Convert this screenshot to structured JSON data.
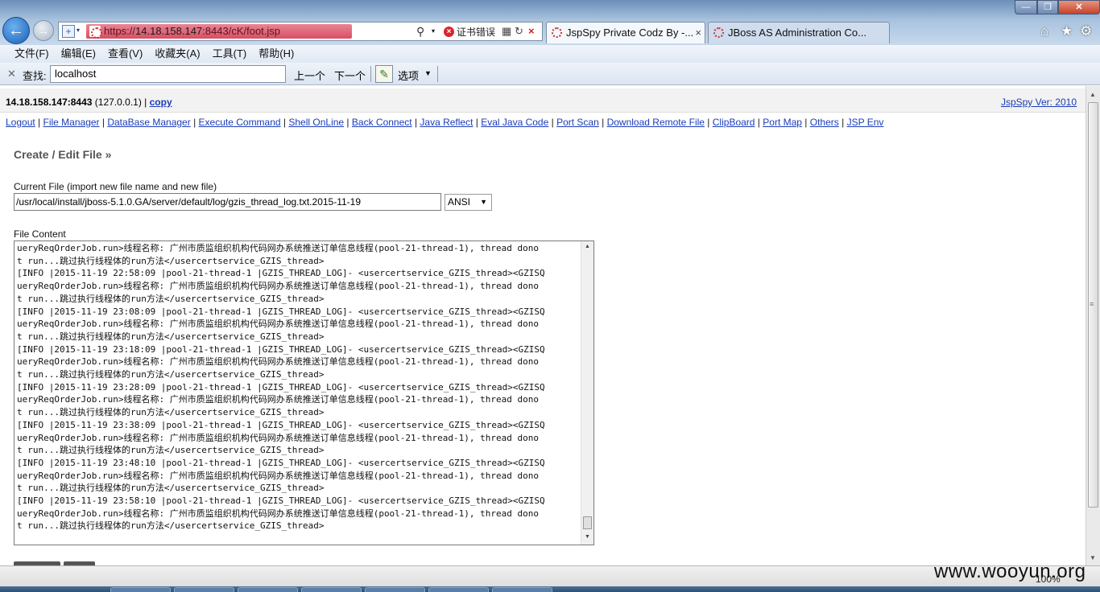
{
  "browser": {
    "url_prefix": "https://",
    "url_host": "14.18.158.147",
    "url_rest": ":8443/cK/foot.jsp",
    "cert_error": "证书错误",
    "tabs": [
      {
        "label": "JspSpy Private Codz By -..."
      },
      {
        "label": "JBoss AS Administration Co..."
      }
    ]
  },
  "menu": {
    "items": [
      "文件(F)",
      "编辑(E)",
      "查看(V)",
      "收藏夹(A)",
      "工具(T)",
      "帮助(H)"
    ]
  },
  "findbar": {
    "label": "查找:",
    "value": "localhost",
    "prev": "上一个",
    "next": "下一个",
    "options": "选项"
  },
  "page": {
    "host": "14.18.158.147:8443",
    "ip": "(127.0.0.1) |",
    "copy": "copy",
    "version": "JspSpy Ver: 2010",
    "nav": [
      "Logout",
      "File Manager",
      "DataBase Manager",
      "Execute Command",
      "Shell OnLine",
      "Back Connect",
      "Java Reflect",
      "Eval Java Code",
      "Port Scan",
      "Download Remote File",
      "ClipBoard",
      "Port Map",
      "Others",
      "JSP Env"
    ],
    "section_title": "Create / Edit File »",
    "current_file_label": "Current File (import new file name and new file)",
    "current_file_value": "/usr/local/install/jboss-5.1.0.GA/server/default/log/gzis_thread_log.txt.2015-11-19",
    "charset": "ANSI",
    "file_content_label": "File Content",
    "file_lines": [
      "ueryReqOrderJob.run>线程名称: 广州市质监组织机构代码网办系统推送订单信息线程(pool-21-thread-1), thread dono",
      "t run...跳过执行线程体的run方法</usercertservice_GZIS_thread>",
      "[INFO |2015-11-19 22:58:09 |pool-21-thread-1 |GZIS_THREAD_LOG]- <usercertservice_GZIS_thread><GZISQ",
      "ueryReqOrderJob.run>线程名称: 广州市质监组织机构代码网办系统推送订单信息线程(pool-21-thread-1), thread dono",
      "t run...跳过执行线程体的run方法</usercertservice_GZIS_thread>",
      "[INFO |2015-11-19 23:08:09 |pool-21-thread-1 |GZIS_THREAD_LOG]- <usercertservice_GZIS_thread><GZISQ",
      "ueryReqOrderJob.run>线程名称: 广州市质监组织机构代码网办系统推送订单信息线程(pool-21-thread-1), thread dono",
      "t run...跳过执行线程体的run方法</usercertservice_GZIS_thread>",
      "[INFO |2015-11-19 23:18:09 |pool-21-thread-1 |GZIS_THREAD_LOG]- <usercertservice_GZIS_thread><GZISQ",
      "ueryReqOrderJob.run>线程名称: 广州市质监组织机构代码网办系统推送订单信息线程(pool-21-thread-1), thread dono",
      "t run...跳过执行线程体的run方法</usercertservice_GZIS_thread>",
      "[INFO |2015-11-19 23:28:09 |pool-21-thread-1 |GZIS_THREAD_LOG]- <usercertservice_GZIS_thread><GZISQ",
      "ueryReqOrderJob.run>线程名称: 广州市质监组织机构代码网办系统推送订单信息线程(pool-21-thread-1), thread dono",
      "t run...跳过执行线程体的run方法</usercertservice_GZIS_thread>",
      "[INFO |2015-11-19 23:38:09 |pool-21-thread-1 |GZIS_THREAD_LOG]- <usercertservice_GZIS_thread><GZISQ",
      "ueryReqOrderJob.run>线程名称: 广州市质监组织机构代码网办系统推送订单信息线程(pool-21-thread-1), thread dono",
      "t run...跳过执行线程体的run方法</usercertservice_GZIS_thread>",
      "[INFO |2015-11-19 23:48:10 |pool-21-thread-1 |GZIS_THREAD_LOG]- <usercertservice_GZIS_thread><GZISQ",
      "ueryReqOrderJob.run>线程名称: 广州市质监组织机构代码网办系统推送订单信息线程(pool-21-thread-1), thread dono",
      "t run...跳过执行线程体的run方法</usercertservice_GZIS_thread>",
      "[INFO |2015-11-19 23:58:10 |pool-21-thread-1 |GZIS_THREAD_LOG]- <usercertservice_GZIS_thread><GZISQ",
      "ueryReqOrderJob.run>线程名称: 广州市质监组织机构代码网办系统推送订单信息线程(pool-21-thread-1), thread dono",
      "t run...跳过执行线程体的run方法</usercertservice_GZIS_thread>"
    ]
  },
  "status": {
    "zoom": "100%",
    "watermark": "www.wooyun.org"
  }
}
